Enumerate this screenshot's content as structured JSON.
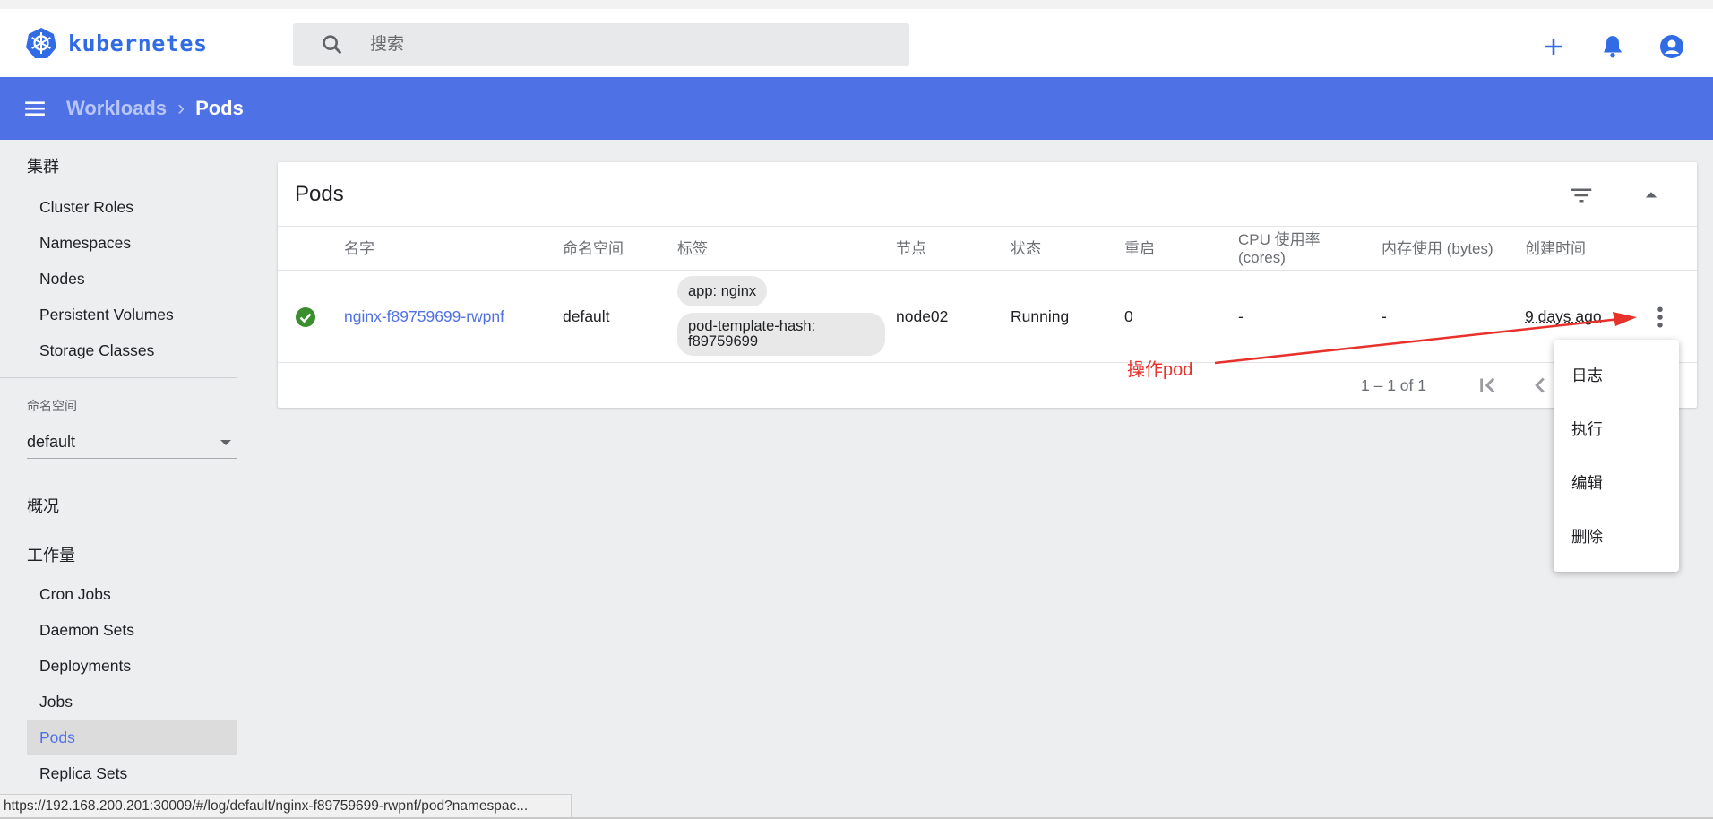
{
  "colors": {
    "brand": "#326ce5",
    "toolbar": "#4f71e6",
    "link": "#4f71e6",
    "success": "#3a8e2d",
    "annotation": "#e8312b"
  },
  "header": {
    "logo_text": "kubernetes",
    "search_placeholder": "搜索",
    "actions": [
      "plus-icon",
      "bell-icon",
      "account-icon"
    ]
  },
  "toolbar": {
    "breadcrumb": [
      "Workloads",
      "Pods"
    ]
  },
  "sidebar": {
    "cluster_heading": "集群",
    "cluster_items": [
      "Cluster Roles",
      "Namespaces",
      "Nodes",
      "Persistent Volumes",
      "Storage Classes"
    ],
    "namespace_label": "命名空间",
    "namespace_value": "default",
    "overview": "概况",
    "workloads_heading": "工作量",
    "workload_items": [
      "Cron Jobs",
      "Daemon Sets",
      "Deployments",
      "Jobs",
      "Pods",
      "Replica Sets"
    ],
    "active_item": "Pods"
  },
  "card": {
    "title": "Pods",
    "columns": [
      "名字",
      "命名空间",
      "标签",
      "节点",
      "状态",
      "重启",
      "CPU 使用率 (cores)",
      "内存使用 (bytes)",
      "创建时间"
    ],
    "rows": [
      {
        "status_icon": "check-circle-icon",
        "name": "nginx-f89759699-rwpnf",
        "namespace": "default",
        "labels": [
          "app: nginx",
          "pod-template-hash: f89759699"
        ],
        "node": "node02",
        "status": "Running",
        "restarts": "0",
        "cpu": "-",
        "memory": "-",
        "created": "9 days ago"
      }
    ],
    "pagination": "1 – 1 of 1"
  },
  "context_menu": {
    "items": [
      "日志",
      "执行",
      "编辑",
      "删除"
    ]
  },
  "annotation": {
    "text": "操作pod"
  },
  "status_url": "https://192.168.200.201:30009/#/log/default/nginx-f89759699-rwpnf/pod?namespac..."
}
